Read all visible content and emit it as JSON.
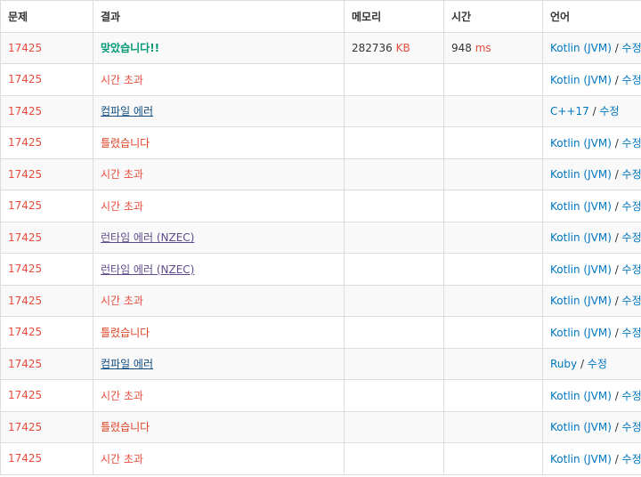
{
  "headers": [
    "문제",
    "결과",
    "메모리",
    "시간",
    "언어"
  ],
  "edit_label": "수정",
  "separator": " / ",
  "rows": [
    {
      "problem": "17425",
      "result": "맞았습니다!!",
      "result_type": "ac",
      "memory": "282736",
      "memory_unit": "KB",
      "time": "948",
      "time_unit": "ms",
      "language": "Kotlin (JVM)"
    },
    {
      "problem": "17425",
      "result": "시간 초과",
      "result_type": "tle",
      "memory": "",
      "memory_unit": "",
      "time": "",
      "time_unit": "",
      "language": "Kotlin (JVM)"
    },
    {
      "problem": "17425",
      "result": "컴파일 에러",
      "result_type": "ce",
      "memory": "",
      "memory_unit": "",
      "time": "",
      "time_unit": "",
      "language": "C++17"
    },
    {
      "problem": "17425",
      "result": "틀렸습니다",
      "result_type": "wa",
      "memory": "",
      "memory_unit": "",
      "time": "",
      "time_unit": "",
      "language": "Kotlin (JVM)"
    },
    {
      "problem": "17425",
      "result": "시간 초과",
      "result_type": "tle",
      "memory": "",
      "memory_unit": "",
      "time": "",
      "time_unit": "",
      "language": "Kotlin (JVM)"
    },
    {
      "problem": "17425",
      "result": "시간 초과",
      "result_type": "tle",
      "memory": "",
      "memory_unit": "",
      "time": "",
      "time_unit": "",
      "language": "Kotlin (JVM)"
    },
    {
      "problem": "17425",
      "result": "런타임 에러 (NZEC)",
      "result_type": "rte",
      "memory": "",
      "memory_unit": "",
      "time": "",
      "time_unit": "",
      "language": "Kotlin (JVM)"
    },
    {
      "problem": "17425",
      "result": "런타임 에러 (NZEC)",
      "result_type": "rte",
      "memory": "",
      "memory_unit": "",
      "time": "",
      "time_unit": "",
      "language": "Kotlin (JVM)"
    },
    {
      "problem": "17425",
      "result": "시간 초과",
      "result_type": "tle",
      "memory": "",
      "memory_unit": "",
      "time": "",
      "time_unit": "",
      "language": "Kotlin (JVM)"
    },
    {
      "problem": "17425",
      "result": "틀렸습니다",
      "result_type": "wa",
      "memory": "",
      "memory_unit": "",
      "time": "",
      "time_unit": "",
      "language": "Kotlin (JVM)"
    },
    {
      "problem": "17425",
      "result": "컴파일 에러",
      "result_type": "ce",
      "memory": "",
      "memory_unit": "",
      "time": "",
      "time_unit": "",
      "language": "Ruby"
    },
    {
      "problem": "17425",
      "result": "시간 초과",
      "result_type": "tle",
      "memory": "",
      "memory_unit": "",
      "time": "",
      "time_unit": "",
      "language": "Kotlin (JVM)"
    },
    {
      "problem": "17425",
      "result": "틀렸습니다",
      "result_type": "wa",
      "memory": "",
      "memory_unit": "",
      "time": "",
      "time_unit": "",
      "language": "Kotlin (JVM)"
    },
    {
      "problem": "17425",
      "result": "시간 초과",
      "result_type": "tle",
      "memory": "",
      "memory_unit": "",
      "time": "",
      "time_unit": "",
      "language": "Kotlin (JVM)"
    }
  ],
  "colors": {
    "accepted": "#009874",
    "time_limit": "#e74c3c",
    "compile_error": "#0f4c81",
    "wrong_answer": "#dd4124",
    "runtime_error": "#5f4b8b",
    "link": "#0076c0",
    "problem_id": "#e74c3c"
  }
}
